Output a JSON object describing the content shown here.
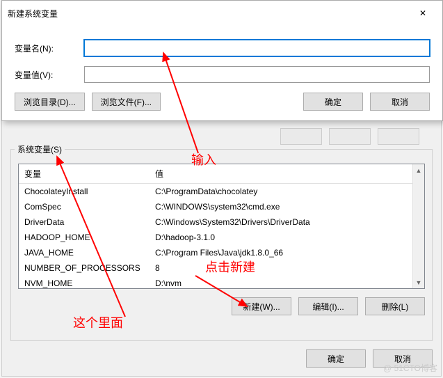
{
  "dialog": {
    "title": "新建系统变量",
    "name_label": "变量名(N):",
    "value_label": "变量值(V):",
    "name_value": "",
    "value_value": "",
    "browse_dir": "浏览目录(D)...",
    "browse_file": "浏览文件(F)...",
    "ok": "确定",
    "cancel": "取消"
  },
  "outer": {
    "group_label": "系统变量(S)",
    "col_var": "变量",
    "col_val": "值",
    "rows": [
      {
        "k": "ChocolateyInstall",
        "v": "C:\\ProgramData\\chocolatey"
      },
      {
        "k": "ComSpec",
        "v": "C:\\WINDOWS\\system32\\cmd.exe"
      },
      {
        "k": "DriverData",
        "v": "C:\\Windows\\System32\\Drivers\\DriverData"
      },
      {
        "k": "HADOOP_HOME",
        "v": "D:\\hadoop-3.1.0"
      },
      {
        "k": "JAVA_HOME",
        "v": "C:\\Program Files\\Java\\jdk1.8.0_66"
      },
      {
        "k": "NUMBER_OF_PROCESSORS",
        "v": "8"
      },
      {
        "k": "NVM_HOME",
        "v": "D:\\nvm"
      }
    ],
    "new_btn": "新建(W)...",
    "edit_btn": "编辑(I)...",
    "del_btn": "删除(L)",
    "ok": "确定",
    "cancel": "取消"
  },
  "annotations": {
    "input": "输入",
    "click_new": "点击新建",
    "this_one": "这个里面"
  },
  "watermark": "@ 51CTO博客"
}
